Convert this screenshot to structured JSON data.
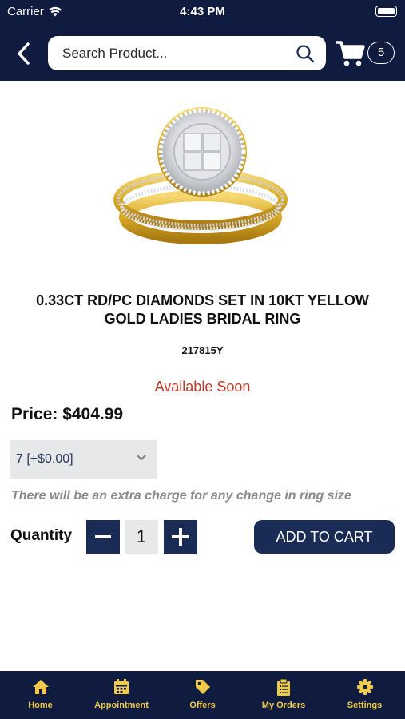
{
  "status_bar": {
    "carrier": "Carrier",
    "time": "4:43 PM"
  },
  "header": {
    "search_placeholder": "Search Product...",
    "cart_count": "5"
  },
  "product": {
    "title": "0.33CT RD/PC DIAMONDS SET IN 10KT YELLOW GOLD LADIES BRIDAL RING",
    "sku": "217815Y",
    "availability": "Available Soon",
    "price": "Price: $404.99",
    "ring_size_selected": "7 [+$0.00]",
    "size_note": "There will be an extra charge for any change in ring size",
    "quantity_label": "Quantity",
    "quantity": "1",
    "add_to_cart_label": "ADD TO CART"
  },
  "tabbar": {
    "items": [
      {
        "label": "Home",
        "icon": "home-icon"
      },
      {
        "label": "Appointment",
        "icon": "calendar-icon"
      },
      {
        "label": "Offers",
        "icon": "tag-icon"
      },
      {
        "label": "My Orders",
        "icon": "clipboard-icon"
      },
      {
        "label": "Settings",
        "icon": "gear-icon"
      }
    ]
  },
  "colors": {
    "header_bg": "#0f1c3f",
    "button_bg": "#1a2b55",
    "availability": "#c0392b",
    "tab_label": "#f0c94a"
  }
}
